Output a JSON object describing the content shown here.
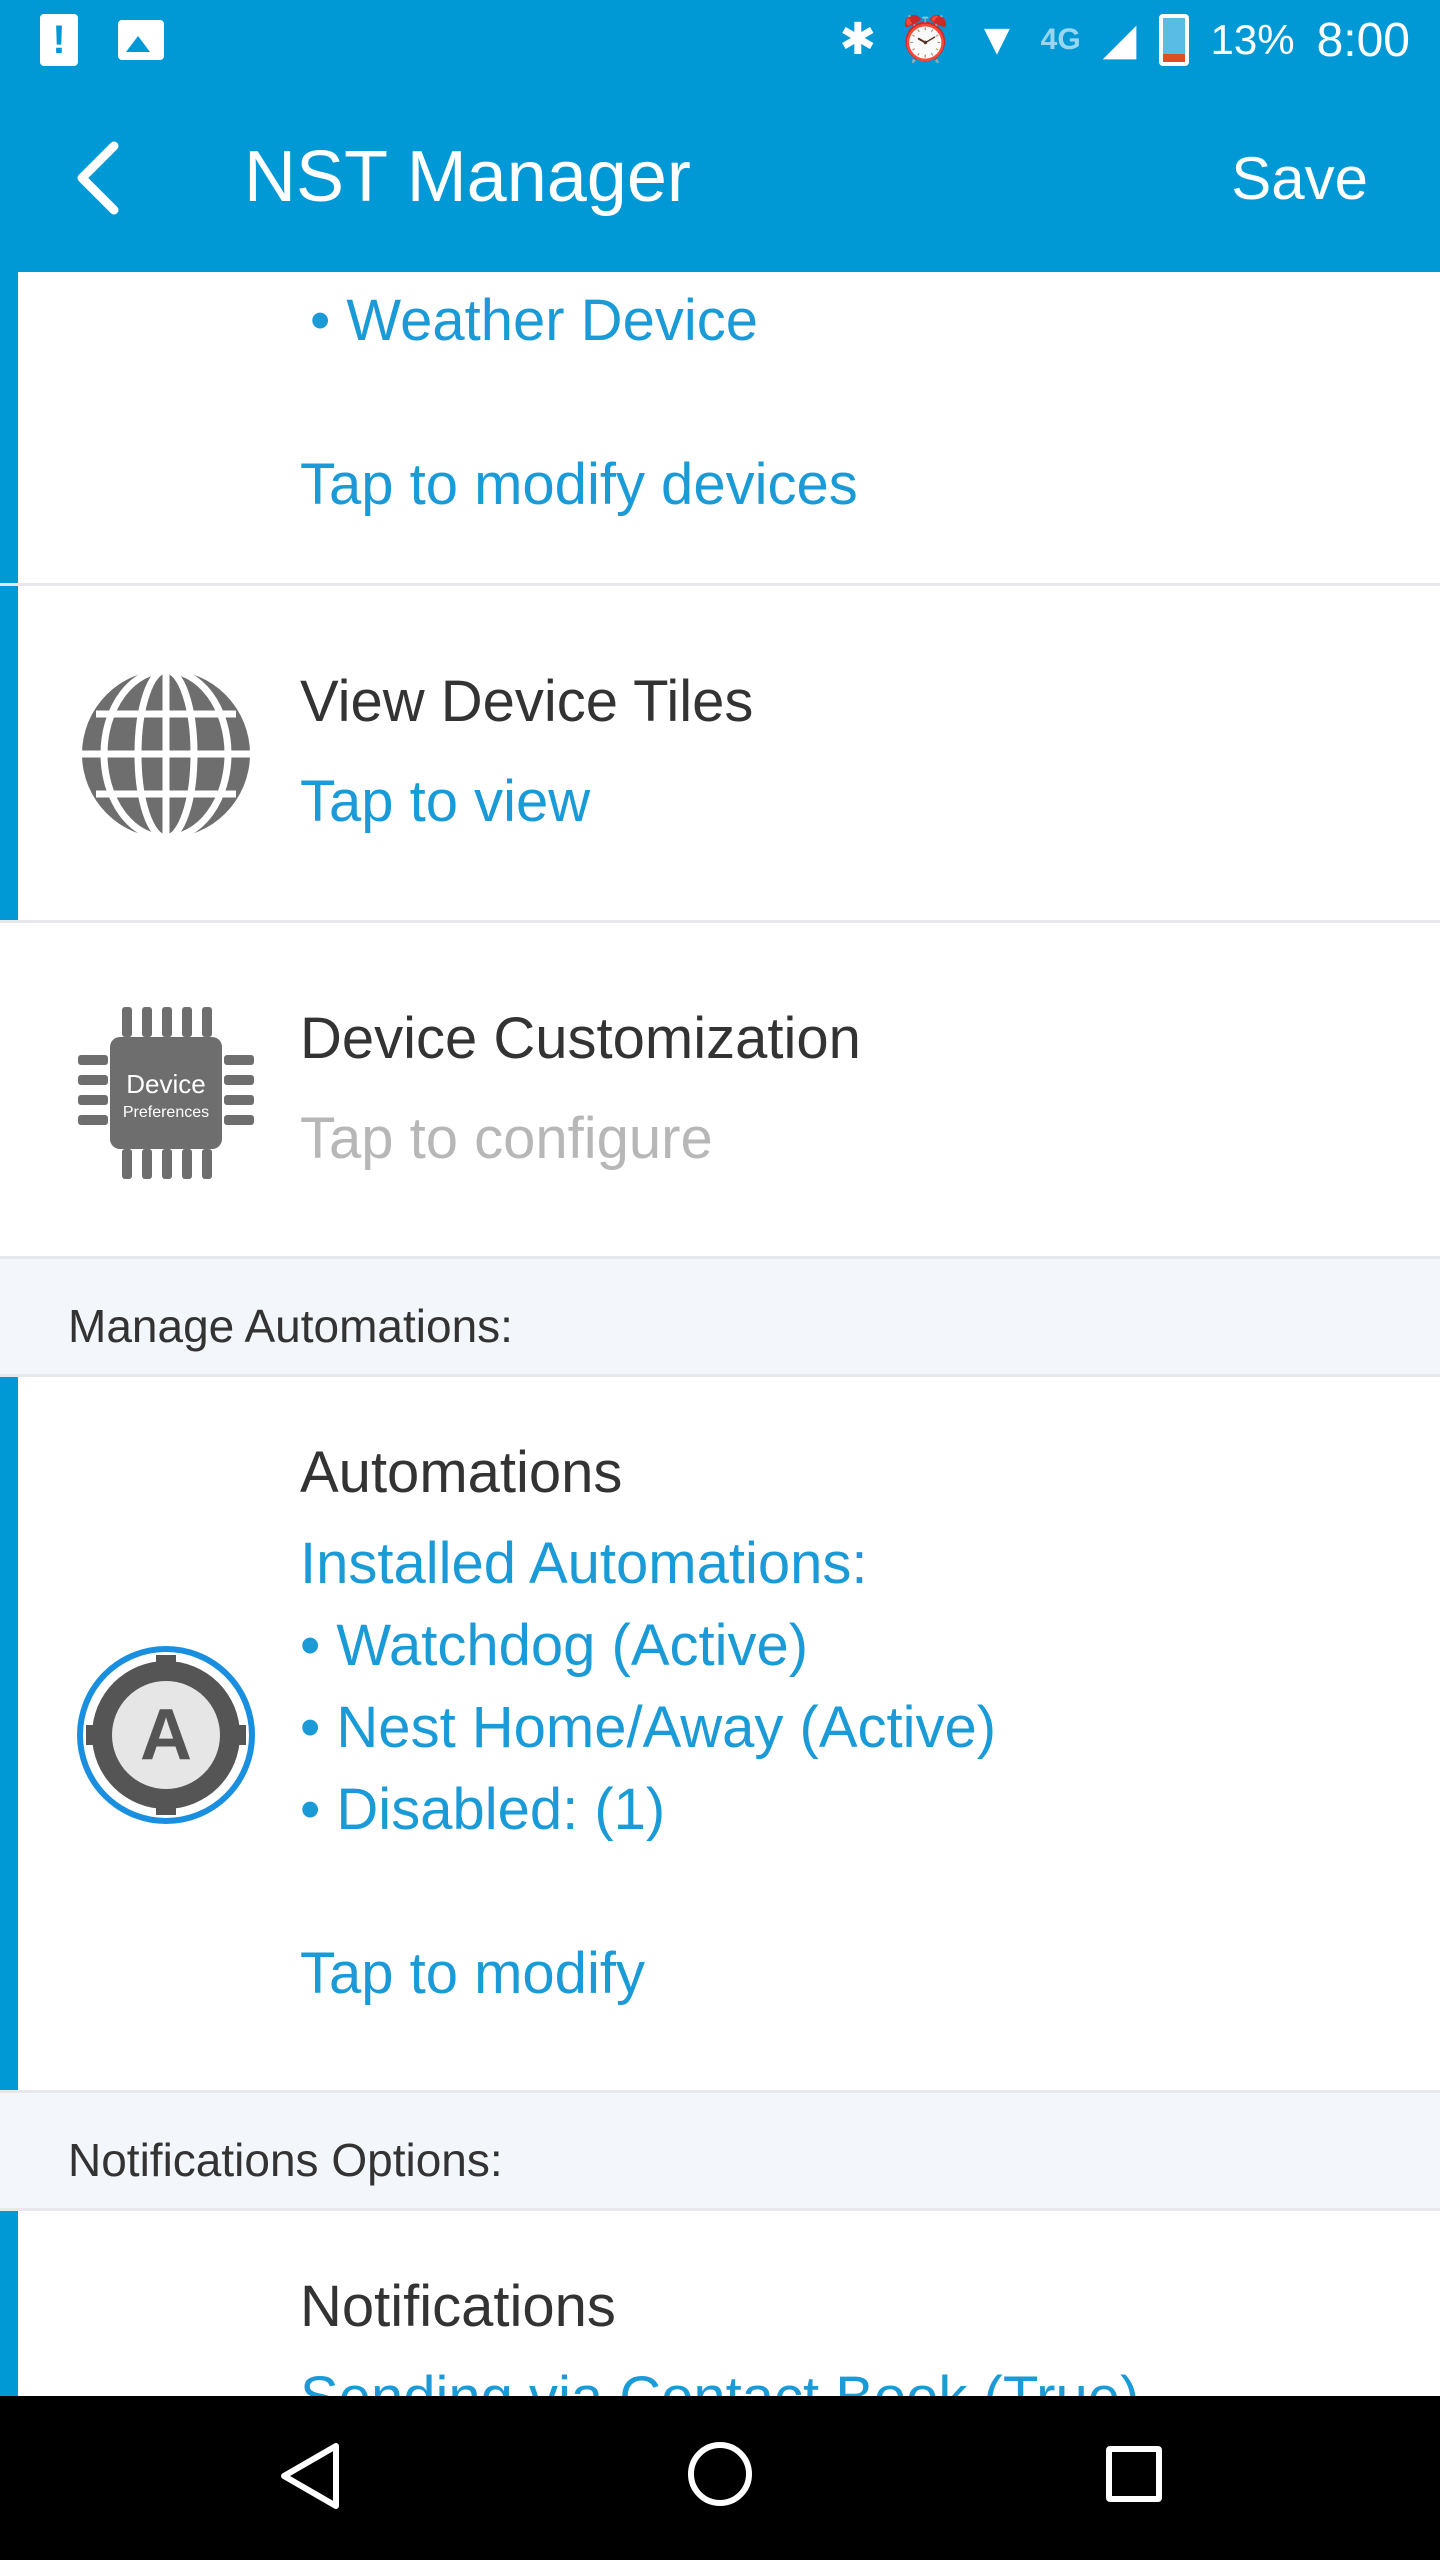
{
  "status_bar": {
    "battery_percent": "13%",
    "time": "8:00",
    "network": "4G",
    "icons": [
      "alert-icon",
      "image-icon",
      "bluetooth-icon",
      "alarm-icon",
      "wifi-icon",
      "signal-icon",
      "battery-icon"
    ]
  },
  "app_bar": {
    "title": "NST Manager",
    "save_label": "Save"
  },
  "devices_row": {
    "item": "• Weather Device",
    "action": "Tap to modify devices"
  },
  "tiles_row": {
    "title": "View Device Tiles",
    "action": "Tap to view"
  },
  "customization_row": {
    "title": "Device Customization",
    "action": "Tap to configure",
    "icon_text_1": "Device",
    "icon_text_2": "Preferences"
  },
  "automations_header": "Manage Automations:",
  "automations_row": {
    "title": "Automations",
    "installed_label": "Installed Automations:",
    "items": [
      "• Watchdog (Active)",
      "• Nest Home/Away (Active)",
      "• Disabled: (1)"
    ],
    "action": "Tap to modify",
    "icon_letter": "A"
  },
  "notifications_header": "Notifications Options:",
  "notifications_row": {
    "title": "Notifications",
    "partial": "Sending via Contact Book (True)"
  },
  "colors": {
    "accent": "#0099d6",
    "link": "#1a9ad6",
    "header_bg": "#f3f6fa"
  }
}
